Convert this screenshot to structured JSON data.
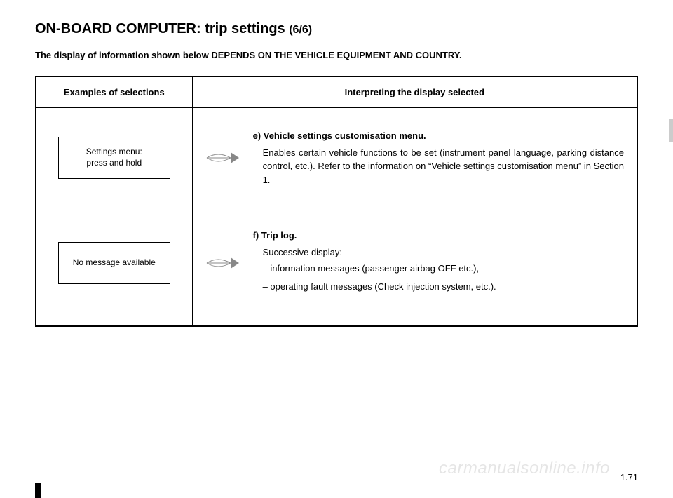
{
  "title_main": "ON-BOARD COMPUTER: trip settings ",
  "title_sub": "(6/6)",
  "depends_note": "The display of information shown below DEPENDS ON THE VEHICLE EQUIPMENT AND COUNTRY.",
  "headers": {
    "left": "Examples of selections",
    "right": "Interpreting the display selected"
  },
  "rows": [
    {
      "display": "Settings menu:\npress and hold",
      "lead": "e) Vehicle settings customisation menu.",
      "body": "Enables certain vehicle functions to be set (instrument panel language, parking distance control, etc.). Refer to the information on “Vehicle settings customisation menu” in Section 1."
    },
    {
      "display": "No message available",
      "lead": "f)  Trip log.",
      "sub": "Successive display:",
      "items": [
        "information messages (passenger airbag OFF etc.),",
        "operating fault messages (Check injection system, etc.)."
      ]
    }
  ],
  "page_number": "1.71",
  "watermark": "carmanualsonline.info"
}
